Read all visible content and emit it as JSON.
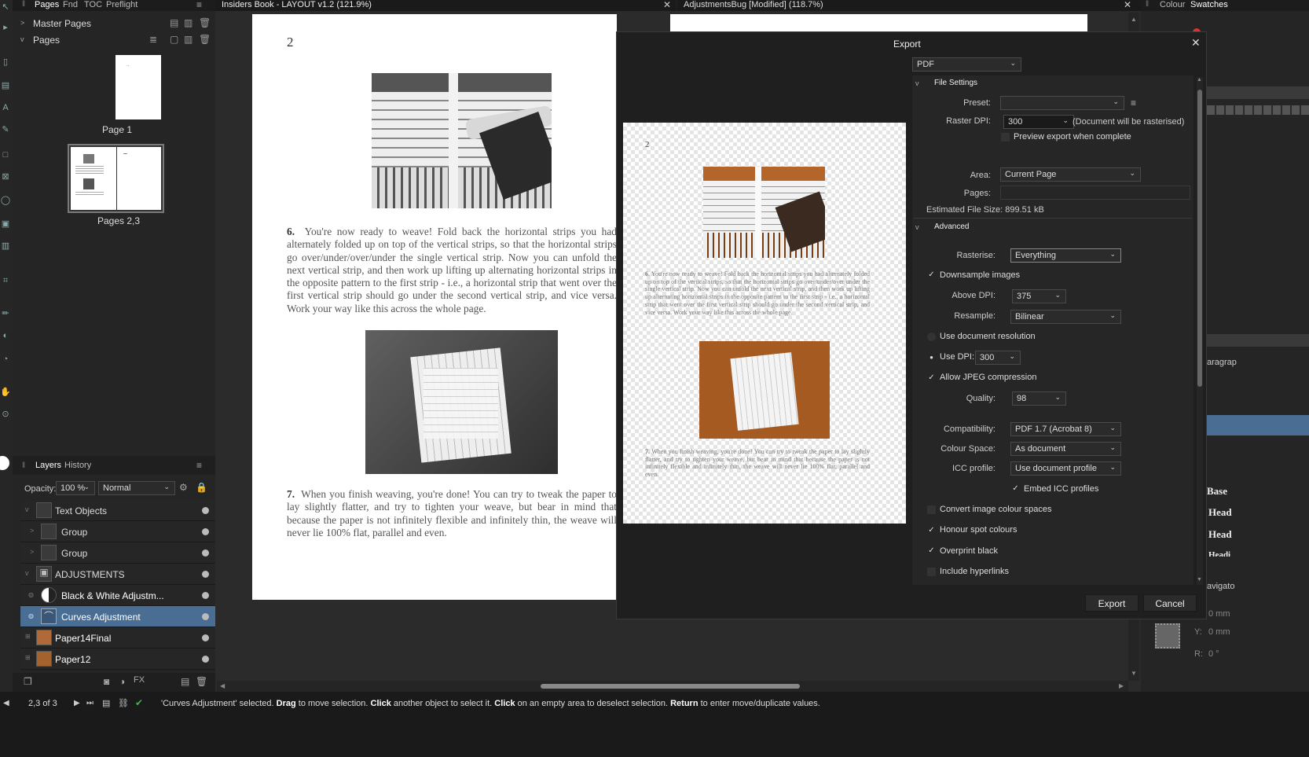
{
  "left_panel": {
    "tabs": [
      "Pages",
      "Fnd",
      "TOC",
      "Preflight"
    ],
    "master_pages": "Master Pages",
    "pages": "Pages",
    "page1_label": "Page 1",
    "page1_text": "..",
    "pages23_label": "Pages 2,3"
  },
  "layers_panel": {
    "tabs": [
      "Layers",
      "History"
    ],
    "opacity_label": "Opacity:",
    "opacity_value": "100 %",
    "blend_mode": "Normal",
    "rows": [
      {
        "label": "Text Objects"
      },
      {
        "label": "Group"
      },
      {
        "label": "Group"
      },
      {
        "label": "ADJUSTMENTS"
      },
      {
        "label": "Black & White Adjustm..."
      },
      {
        "label": "Curves Adjustment"
      },
      {
        "label": "Paper14Final"
      },
      {
        "label": "Paper12"
      }
    ]
  },
  "doc_tabs": {
    "tab1": "Insiders Book - LAYOUT v1.2 (121.9%)",
    "tab2": "AdjustmentsBug [Modified] (118.7%)"
  },
  "document": {
    "page_number": "2",
    "para6_num": "6.",
    "para6": "You're now ready to weave! Fold back the horizontal strips you had alternately folded up on top of the vertical strips, so that the horizontal strips go over/under/over/under the single vertical strip. Now you can unfold the next vertical strip, and then work up lifting up alternating horizontal strips in the opposite pattern to the first strip - i.e., a horizontal strip that went over the first vertical strip should go under the second vertical strip, and vice versa. Work your way like this across the whole page.",
    "para7_num": "7.",
    "para7": "When you finish weaving, you're done! You can try to tweak the paper to lay slightly flatter, and try to tighten your weave, but bear in mind that because the paper is not infinitely flexible and infinitely thin, the weave will never lie 100% flat, parallel and even."
  },
  "right_panel": {
    "tabs": [
      "Colour",
      "Swatches"
    ],
    "text_fragments": [
      "aragrap",
      "Base",
      "Head",
      "Head",
      "Headi",
      "avigato"
    ],
    "x_value": "0 mm",
    "y_label": "Y:",
    "y_value": "0 mm",
    "r_label": "R:",
    "r_value": "0 °"
  },
  "export": {
    "title": "Export",
    "format": "PDF",
    "file_settings": "File Settings",
    "preset_label": "Preset:",
    "preset_value": "",
    "raster_dpi_label": "Raster DPI:",
    "raster_dpi_value": "300",
    "raster_note": "(Document will be rasterised)",
    "preview_label": "Preview export when complete",
    "area_label": "Area:",
    "area_value": "Current Page",
    "pages_label": "Pages:",
    "pages_value": "",
    "file_size": "Estimated File Size: 899.51 kB",
    "advanced": "Advanced",
    "rasterise_label": "Rasterise:",
    "rasterise_value": "Everything",
    "downsample_label": "Downsample images",
    "above_dpi_label": "Above DPI:",
    "above_dpi_value": "375",
    "resample_label": "Resample:",
    "resample_value": "Bilinear",
    "use_doc_res_label": "Use document resolution",
    "use_dpi_label": "Use DPI:",
    "use_dpi_value": "300",
    "jpeg_label": "Allow JPEG compression",
    "quality_label": "Quality:",
    "quality_value": "98",
    "compat_label": "Compatibility:",
    "compat_value": "PDF 1.7 (Acrobat 8)",
    "colour_space_label": "Colour Space:",
    "colour_space_value": "As document",
    "icc_label": "ICC profile:",
    "icc_value": "Use document profile",
    "embed_icc_label": "Embed ICC profiles",
    "convert_label": "Convert image colour spaces",
    "honour_label": "Honour spot colours",
    "overprint_label": "Overprint black",
    "hyperlinks_label": "Include hyperlinks",
    "export_btn": "Export",
    "cancel_btn": "Cancel"
  },
  "status": {
    "page_indicator": "2,3 of 3",
    "msg_parts": [
      "'Curves Adjustment' selected. ",
      "Drag",
      " to move selection. ",
      "Click",
      " another object to select it. ",
      "Click",
      " on an empty area to deselect selection. ",
      "Return",
      " to enter move/duplicate values."
    ]
  },
  "colors": {
    "selection": "#4a6d94",
    "accent_red": "#e03030"
  }
}
